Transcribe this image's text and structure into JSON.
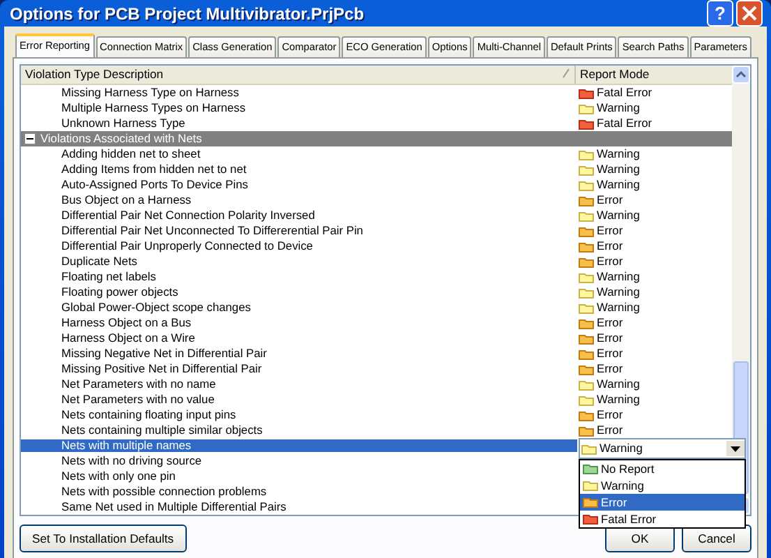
{
  "window": {
    "title": "Options for PCB Project Multivibrator.PrjPcb",
    "help_label": "?"
  },
  "tabs": [
    {
      "label": "Error Reporting",
      "selected": true
    },
    {
      "label": "Connection Matrix",
      "selected": false
    },
    {
      "label": "Class Generation",
      "selected": false
    },
    {
      "label": "Comparator",
      "selected": false
    },
    {
      "label": "ECO Generation",
      "selected": false
    },
    {
      "label": "Options",
      "selected": false
    },
    {
      "label": "Multi-Channel",
      "selected": false
    },
    {
      "label": "Default Prints",
      "selected": false
    },
    {
      "label": "Search Paths",
      "selected": false
    },
    {
      "label": "Parameters",
      "selected": false
    }
  ],
  "table": {
    "columns": [
      "Violation Type Description",
      "Report Mode"
    ],
    "rows": [
      {
        "kind": "item",
        "label": "Missing Harness Type on Harness",
        "mode": {
          "kind": "fatal",
          "label": "Fatal Error"
        },
        "selected": false
      },
      {
        "kind": "item",
        "label": "Multiple Harness Types on Harness",
        "mode": {
          "kind": "warning",
          "label": "Warning"
        },
        "selected": false
      },
      {
        "kind": "item",
        "label": "Unknown Harness Type",
        "mode": {
          "kind": "fatal",
          "label": "Fatal Error"
        },
        "selected": false
      },
      {
        "kind": "group",
        "label": "Violations Associated with Nets",
        "expanded": true,
        "selected": false
      },
      {
        "kind": "item",
        "label": "Adding hidden net to sheet",
        "mode": {
          "kind": "warning",
          "label": "Warning"
        },
        "selected": false
      },
      {
        "kind": "item",
        "label": "Adding Items from hidden net to net",
        "mode": {
          "kind": "warning",
          "label": "Warning"
        },
        "selected": false
      },
      {
        "kind": "item",
        "label": "Auto-Assigned Ports To Device Pins",
        "mode": {
          "kind": "warning",
          "label": "Warning"
        },
        "selected": false
      },
      {
        "kind": "item",
        "label": "Bus Object on a Harness",
        "mode": {
          "kind": "error",
          "label": "Error"
        },
        "selected": false
      },
      {
        "kind": "item",
        "label": "Differential Pair Net Connection Polarity Inversed",
        "mode": {
          "kind": "warning",
          "label": "Warning"
        },
        "selected": false
      },
      {
        "kind": "item",
        "label": "Differential Pair Net Unconnected To Differerential Pair Pin",
        "mode": {
          "kind": "error",
          "label": "Error"
        },
        "selected": false
      },
      {
        "kind": "item",
        "label": "Differential Pair Unproperly Connected to Device",
        "mode": {
          "kind": "error",
          "label": "Error"
        },
        "selected": false
      },
      {
        "kind": "item",
        "label": "Duplicate Nets",
        "mode": {
          "kind": "error",
          "label": "Error"
        },
        "selected": false
      },
      {
        "kind": "item",
        "label": "Floating net labels",
        "mode": {
          "kind": "warning",
          "label": "Warning"
        },
        "selected": false
      },
      {
        "kind": "item",
        "label": "Floating power objects",
        "mode": {
          "kind": "warning",
          "label": "Warning"
        },
        "selected": false
      },
      {
        "kind": "item",
        "label": "Global Power-Object scope changes",
        "mode": {
          "kind": "warning",
          "label": "Warning"
        },
        "selected": false
      },
      {
        "kind": "item",
        "label": "Harness Object on a Bus",
        "mode": {
          "kind": "error",
          "label": "Error"
        },
        "selected": false
      },
      {
        "kind": "item",
        "label": "Harness Object on a Wire",
        "mode": {
          "kind": "error",
          "label": "Error"
        },
        "selected": false
      },
      {
        "kind": "item",
        "label": "Missing Negative Net in Differential Pair",
        "mode": {
          "kind": "error",
          "label": "Error"
        },
        "selected": false
      },
      {
        "kind": "item",
        "label": "Missing Positive Net in Differential Pair",
        "mode": {
          "kind": "error",
          "label": "Error"
        },
        "selected": false
      },
      {
        "kind": "item",
        "label": "Net Parameters with no name",
        "mode": {
          "kind": "warning",
          "label": "Warning"
        },
        "selected": false
      },
      {
        "kind": "item",
        "label": "Net Parameters with no value",
        "mode": {
          "kind": "warning",
          "label": "Warning"
        },
        "selected": false
      },
      {
        "kind": "item",
        "label": "Nets containing floating input pins",
        "mode": {
          "kind": "error",
          "label": "Error"
        },
        "selected": false
      },
      {
        "kind": "item",
        "label": "Nets containing multiple similar objects",
        "mode": {
          "kind": "error",
          "label": "Error"
        },
        "selected": false
      },
      {
        "kind": "item",
        "label": "Nets with multiple names",
        "mode": {
          "kind": "warning",
          "label": "Warning"
        },
        "selected": true
      },
      {
        "kind": "item",
        "label": "Nets with no driving source",
        "selected": false
      },
      {
        "kind": "item",
        "label": "Nets with only one pin",
        "selected": false
      },
      {
        "kind": "item",
        "label": "Nets with possible connection problems",
        "selected": false
      },
      {
        "kind": "item",
        "label": "Same Net used in Multiple Differential Pairs",
        "selected": false
      }
    ]
  },
  "dropdown": {
    "options": [
      {
        "kind": "none",
        "label": "No Report",
        "selected": false
      },
      {
        "kind": "warning",
        "label": "Warning",
        "selected": false
      },
      {
        "kind": "error",
        "label": "Error",
        "selected": true
      },
      {
        "kind": "fatal",
        "label": "Fatal Error",
        "selected": false
      }
    ]
  },
  "buttons": {
    "defaults": "Set To Installation Defaults",
    "ok": "OK",
    "cancel": "Cancel"
  }
}
